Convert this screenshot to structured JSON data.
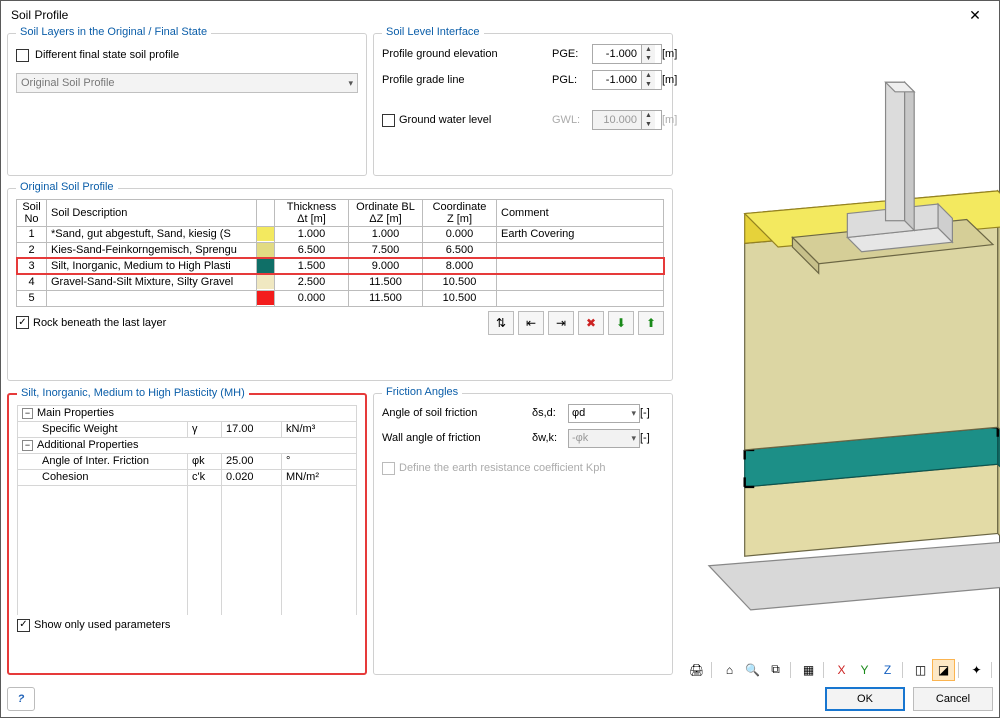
{
  "window": {
    "title": "Soil Profile"
  },
  "layers_panel": {
    "legend": "Soil Layers in the Original / Final State",
    "diff_checkbox_label": "Different final state soil profile",
    "dropdown_value": "Original Soil Profile"
  },
  "level_panel": {
    "legend": "Soil Level Interface",
    "pge_label": "Profile ground elevation",
    "pge_code": "PGE:",
    "pge_value": "-1.000",
    "pgl_label": "Profile grade line",
    "pgl_code": "PGL:",
    "pgl_value": "-1.000",
    "gwl_label": "Ground water level",
    "gwl_code": "GWL:",
    "gwl_value": "10.000",
    "unit": "[m]"
  },
  "profile_panel": {
    "legend": "Original Soil Profile",
    "header_no": "Soil\nNo",
    "header_desc": "Soil Description",
    "header_thk": "Thickness\nΔt [m]",
    "header_ord": "Ordinate BL\nΔZ [m]",
    "header_z": "Coordinate\nZ [m]",
    "header_comment": "Comment",
    "rows": [
      {
        "no": "1",
        "desc": "*Sand, gut abgestuft, Sand, kiesig (S",
        "color": "#f3e95f",
        "thk": "1.000",
        "ord": "1.000",
        "z": "0.000",
        "comment": "Earth Covering",
        "selected": false
      },
      {
        "no": "2",
        "desc": "Kies-Sand-Feinkorngemisch, Sprengu",
        "color": "#e2db83",
        "thk": "6.500",
        "ord": "7.500",
        "z": "6.500",
        "comment": "",
        "selected": false
      },
      {
        "no": "3",
        "desc": "Silt, Inorganic, Medium to High Plasti",
        "color": "#0f6f67",
        "thk": "1.500",
        "ord": "9.000",
        "z": "8.000",
        "comment": "",
        "selected": true
      },
      {
        "no": "4",
        "desc": "Gravel-Sand-Silt Mixture, Silty Gravel",
        "color": "#f0e8c1",
        "thk": "2.500",
        "ord": "11.500",
        "z": "10.500",
        "comment": "",
        "selected": false
      },
      {
        "no": "5",
        "desc": "",
        "color": "#f31c1c",
        "thk": "0.000",
        "ord": "11.500",
        "z": "10.500",
        "comment": "",
        "selected": false
      }
    ],
    "rock_label": "Rock beneath the last layer"
  },
  "props_panel": {
    "legend": "Silt, Inorganic, Medium to High Plasticity (MH)",
    "sec_main": "Main Properties",
    "sec_add": "Additional Properties",
    "p_specific_weight": "Specific Weight",
    "p_specific_weight_sym": "γ",
    "p_specific_weight_val": "17.00",
    "p_specific_weight_unit": "kN/m³",
    "p_angle": "Angle of Inter. Friction",
    "p_angle_sym": "φk",
    "p_angle_val": "25.00",
    "p_angle_unit": "°",
    "p_cohesion": "Cohesion",
    "p_cohesion_sym": "c'k",
    "p_cohesion_val": "0.020",
    "p_cohesion_unit": "MN/m²",
    "show_only_label": "Show only used parameters"
  },
  "friction_panel": {
    "legend": "Friction Angles",
    "soil_label": "Angle of soil friction",
    "soil_sym": "δs,d:",
    "soil_val": "φd",
    "wall_label": "Wall angle of friction",
    "wall_sym": "δw,k:",
    "wall_val": "-φk",
    "unit": "[-]",
    "kph_label": "Define the earth resistance coefficient Kph"
  },
  "buttons": {
    "ok": "OK",
    "cancel": "Cancel"
  },
  "viewer_icons": [
    "print-icon",
    "home-icon",
    "zoom-icon",
    "zoom-window-icon",
    "grid-icon",
    "view-x-icon",
    "view-y-icon",
    "view-z-icon",
    "iso-icon",
    "iso2-icon",
    "axis-icon",
    "measure-icon",
    "arrows-icon",
    "sync-icon"
  ]
}
